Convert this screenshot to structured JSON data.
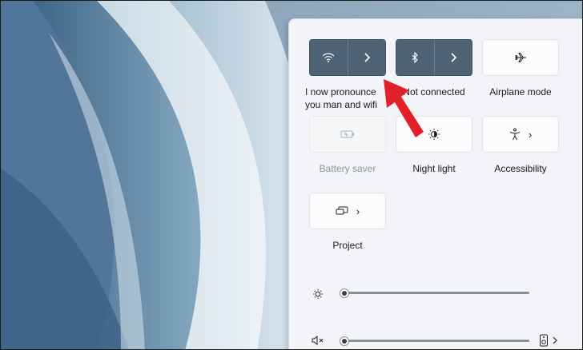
{
  "quick_settings": {
    "tiles": [
      {
        "id": "wifi",
        "label": "I now pronounce you man and wifi",
        "label_line1": "I now pronounce",
        "label_line2": "you man and wifi",
        "icon": "wifi-icon",
        "state": "on"
      },
      {
        "id": "bluetooth",
        "label": "Not connected",
        "icon": "bluetooth-icon",
        "state": "on"
      },
      {
        "id": "airplane",
        "label": "Airplane mode",
        "icon": "airplane-icon",
        "state": "off"
      },
      {
        "id": "battery_saver",
        "label": "Battery saver",
        "icon": "battery-saver-icon",
        "state": "disabled"
      },
      {
        "id": "night_light",
        "label": "Night light",
        "icon": "night-light-icon",
        "state": "off"
      },
      {
        "id": "accessibility",
        "label": "Accessibility",
        "icon": "accessibility-icon",
        "state": "off"
      },
      {
        "id": "project",
        "label": "Project",
        "icon": "project-icon",
        "state": "off"
      }
    ],
    "brightness": {
      "icon": "brightness-icon",
      "level": 0
    },
    "volume": {
      "icon": "muted-speaker-icon",
      "level": 0,
      "output_icon": "speaker-device-icon"
    }
  },
  "colors": {
    "active_tile": "#4d6272",
    "annotation_arrow": "#e2202a"
  }
}
